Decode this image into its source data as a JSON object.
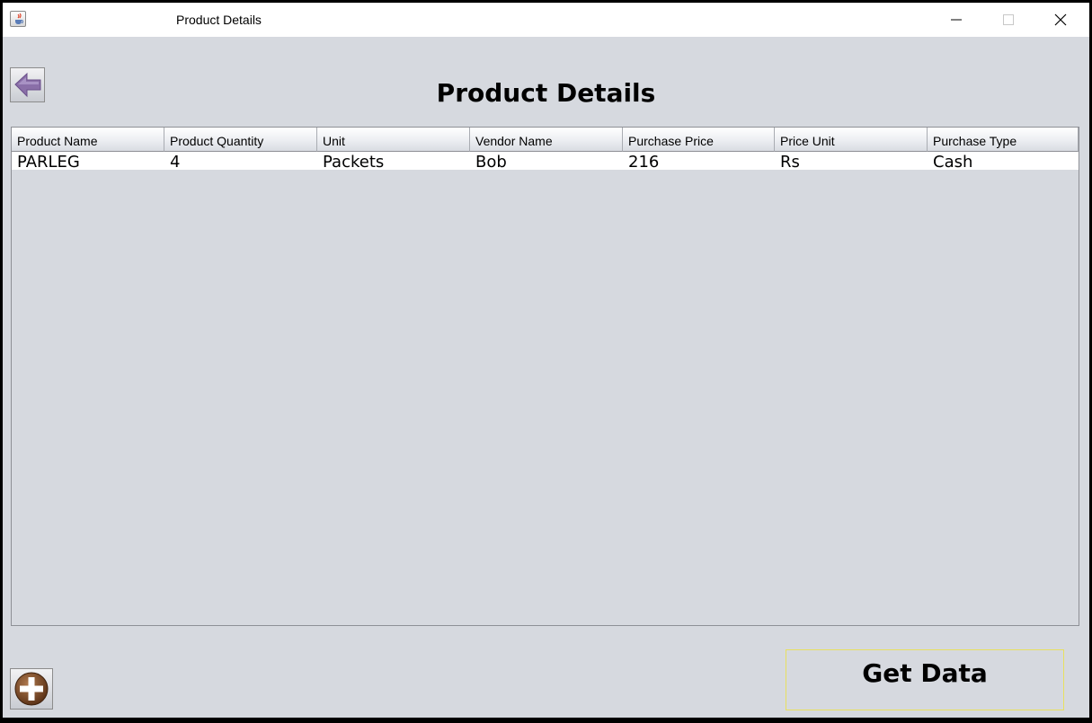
{
  "window": {
    "title": "Product Details",
    "icon": "java-cup-icon",
    "controls": [
      "minimize-icon",
      "maximize-icon",
      "close-icon"
    ]
  },
  "toolbar": {
    "back_icon": "back-arrow-icon"
  },
  "heading": "Product Details",
  "table": {
    "columns": [
      "Product Name",
      "Product Quantity",
      "Unit",
      "Vendor Name",
      "Purchase Price",
      "Price Unit",
      "Purchase Type"
    ],
    "rows": [
      [
        "PARLEG",
        "4",
        "Packets",
        "Bob",
        "216",
        "Rs",
        "Cash"
      ]
    ]
  },
  "footer": {
    "add_icon": "add-circle-icon",
    "get_data_label": "Get Data"
  },
  "colors": {
    "background": "#d6d9df",
    "button_border_accent": "#e8e060",
    "back_arrow": "#8a6fa8"
  }
}
